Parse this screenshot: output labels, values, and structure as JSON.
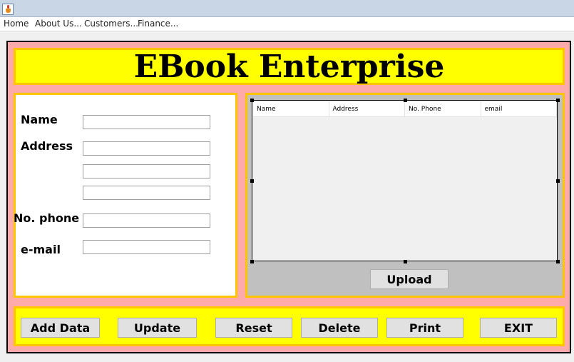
{
  "window": {
    "app_icon": "java-cup-icon"
  },
  "menu": {
    "items": [
      {
        "label": "Home"
      },
      {
        "label": "About Us..."
      },
      {
        "label": "Customers..."
      },
      {
        "label": "Finance..."
      }
    ]
  },
  "header": {
    "title": "EBook Enterprise"
  },
  "form": {
    "name_label": "Name",
    "address_label": "Address",
    "phone_label": "No. phone",
    "email_label": "e-mail",
    "name_value": "",
    "address_line1": "",
    "address_line2": "",
    "address_line3": "",
    "phone_value": "",
    "email_value": ""
  },
  "table": {
    "columns": [
      "Name",
      "Address",
      "No. Phone",
      "email"
    ],
    "rows": []
  },
  "upload_label": "Upload",
  "actions": {
    "add": "Add Data",
    "update": "Update",
    "reset": "Reset",
    "delete": "Delete",
    "print": "Print",
    "exit": "EXIT"
  },
  "colors": {
    "frame_bg": "#ffaaaa",
    "header_bg": "#ffff00",
    "panel_border": "#ffc400",
    "table_panel_bg": "#c0c0c0"
  }
}
